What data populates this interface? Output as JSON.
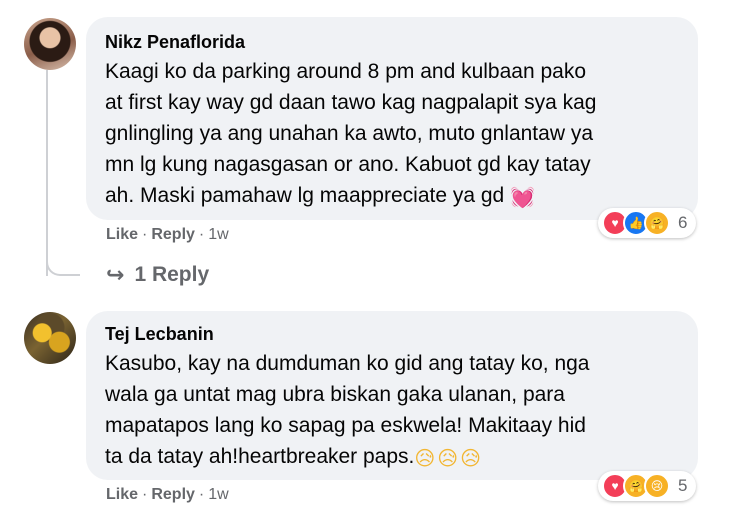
{
  "comments": [
    {
      "author": "Nikz Penaflorida",
      "text": "Kaagi ko da parking around 8 pm and kulbaan pako\nat first kay way gd daan tawo kag nagpalapit sya kag\ngnlingling ya ang unahan ka awto, muto gnlantaw ya\nmn lg kung nagasgasan or ano. Kabuot gd kay tatay\nah. Maski pamahaw lg maappreciate ya gd",
      "trailing_emoji": "💓",
      "reaction_icons": [
        "love",
        "like",
        "care"
      ],
      "reaction_count": "6",
      "like_label": "Like",
      "reply_label": "Reply",
      "time": "1w",
      "replies_label": "1 Reply"
    },
    {
      "author": "Tej Lecbanin",
      "text": "Kasubo, kay na dumduman ko gid ang tatay ko, nga\nwala ga untat mag ubra biskan gaka ulanan, para\nmapatapos lang ko sapag pa eskwela! Makitaay hid\nta da tatay ah!heartbreaker paps.",
      "trailing_emoji": "😥😥😥",
      "reaction_icons": [
        "love",
        "care",
        "sad"
      ],
      "reaction_count": "5",
      "like_label": "Like",
      "reply_label": "Reply",
      "time": "1w"
    }
  ],
  "separator": "·",
  "colors": {
    "bubble": "#f0f2f5",
    "secondary_text": "#65676b",
    "like_blue": "#1877f2",
    "love_red": "#f33e58",
    "care_yellow": "#f7b125"
  }
}
